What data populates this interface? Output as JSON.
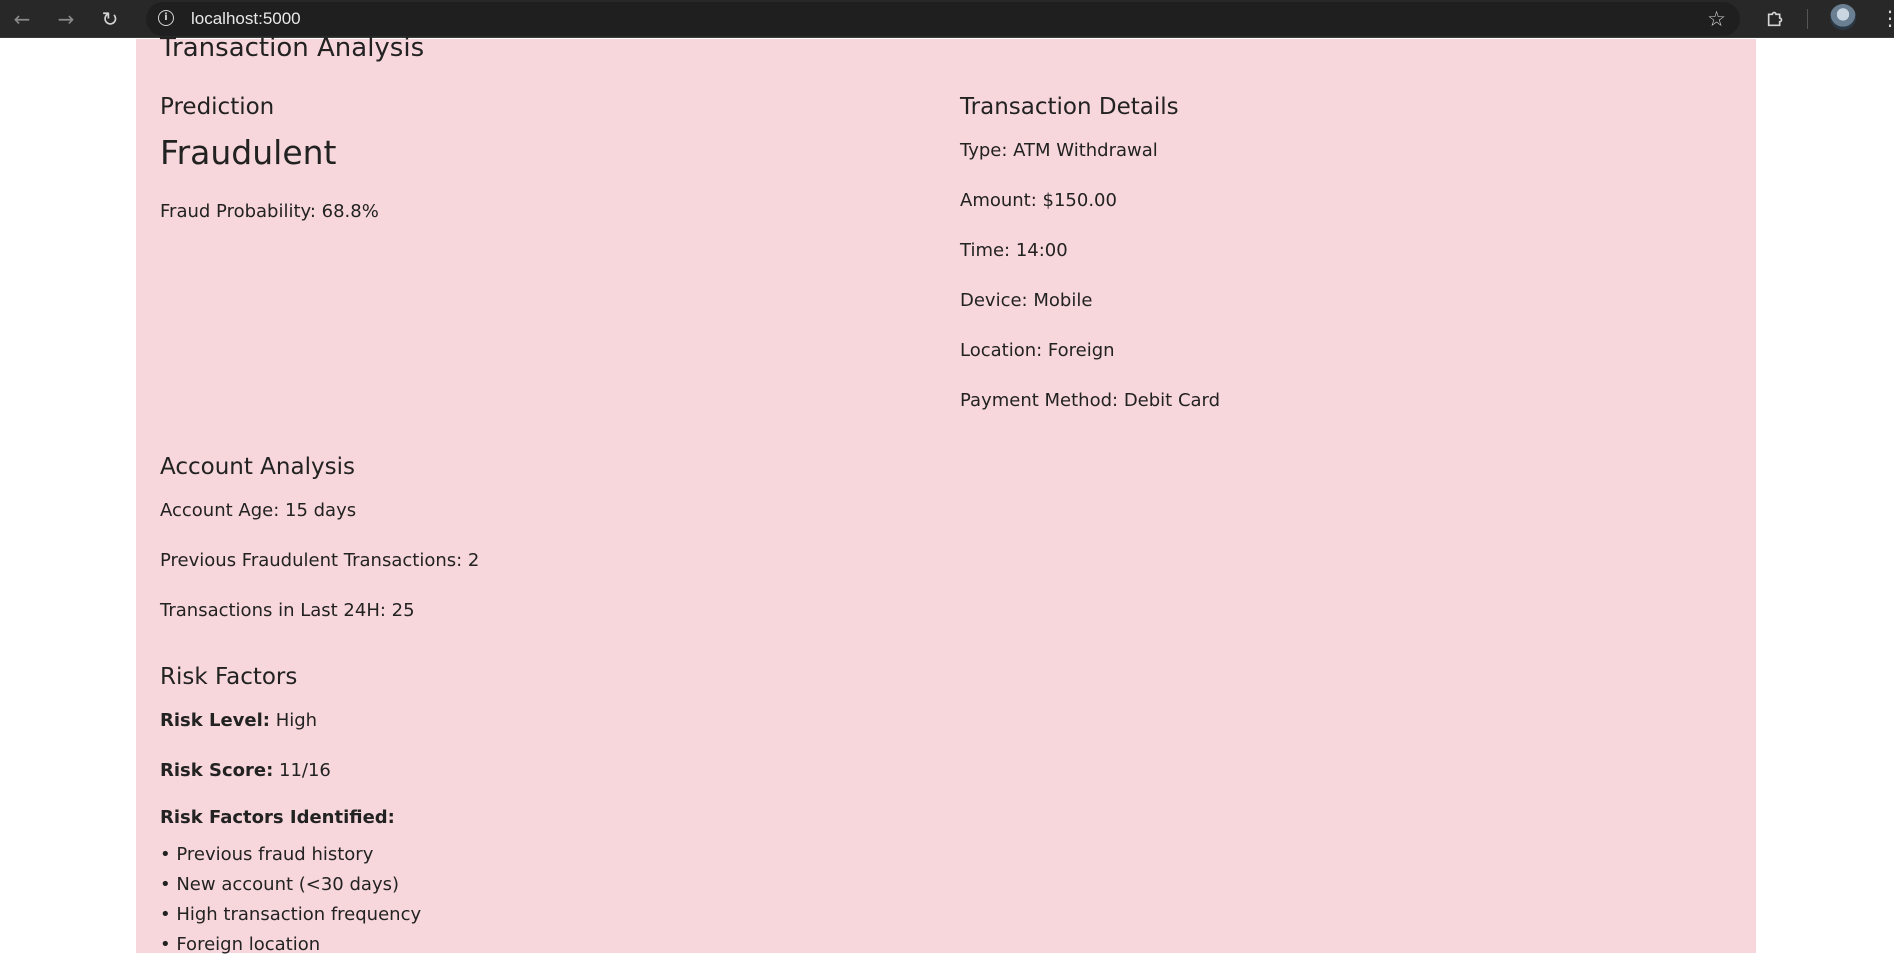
{
  "browser": {
    "url": "localhost:5000",
    "icons": [
      "back-arrow-icon",
      "forward-arrow-icon",
      "reload-icon",
      "info-icon",
      "star-icon",
      "extensions-icon",
      "avatar",
      "menu-icon"
    ]
  },
  "page": {
    "title": "Transaction Analysis",
    "prediction": {
      "heading": "Prediction",
      "result": "Fraudulent",
      "probability_text": "Fraud Probability: 68.8%"
    },
    "transaction_details": {
      "heading": "Transaction Details",
      "items": [
        "Type: ATM Withdrawal",
        "Amount: $150.00",
        "Time: 14:00",
        "Device: Mobile",
        "Location: Foreign",
        "Payment Method: Debit Card"
      ]
    },
    "account_analysis": {
      "heading": "Account Analysis",
      "items": [
        "Account Age: 15 days",
        "Previous Fraudulent Transactions: 2",
        "Transactions in Last 24H: 25"
      ]
    },
    "risk_factors": {
      "heading": "Risk Factors",
      "risk_level_label": "Risk Level:",
      "risk_level_value": "High",
      "risk_score_label": "Risk Score:",
      "risk_score_value": "11/16",
      "identified_label": "Risk Factors Identified:",
      "factors": [
        "• Previous fraud history",
        "• New account (<30 days)",
        "• High transaction frequency",
        "• Foreign location"
      ]
    }
  },
  "colors": {
    "panel_background": "#f7d7db",
    "browser_bar": "#282828"
  }
}
